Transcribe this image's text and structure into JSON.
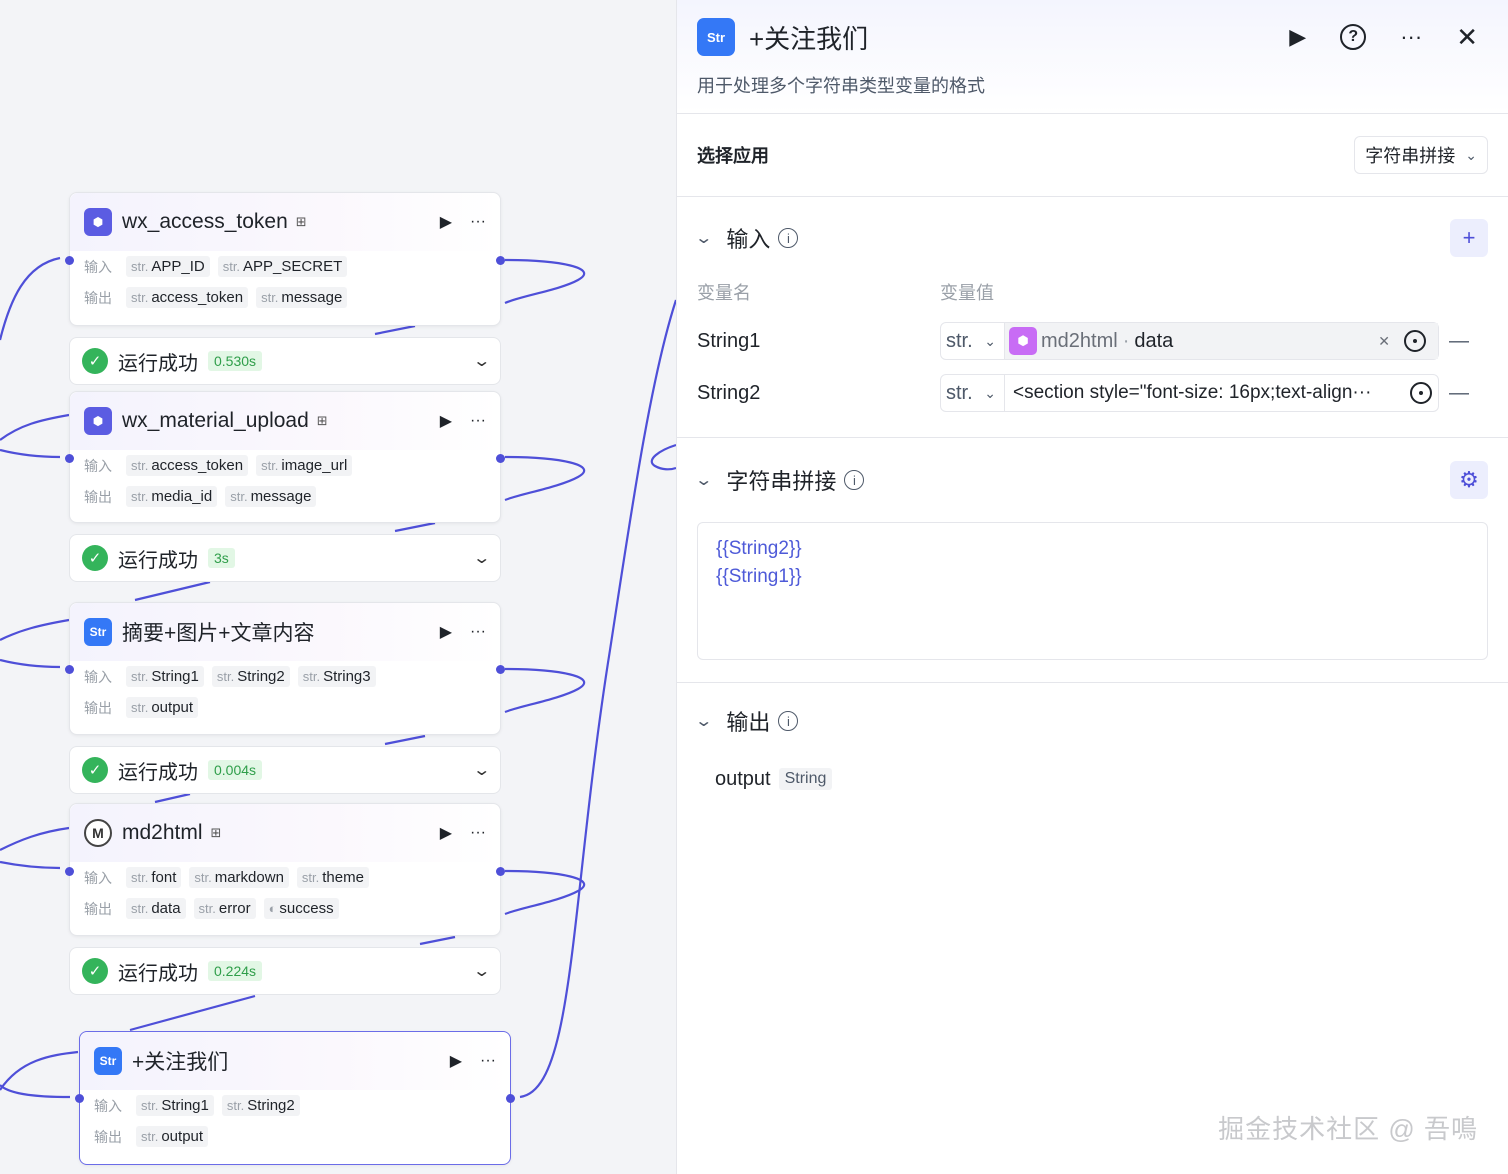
{
  "nodes": [
    {
      "title": "wx_access_token",
      "icon": "cube-icon",
      "inputs": [
        {
          "t": "str.",
          "n": "APP_ID"
        },
        {
          "t": "str.",
          "n": "APP_SECRET"
        }
      ],
      "outputs": [
        {
          "t": "str.",
          "n": "access_token"
        },
        {
          "t": "str.",
          "n": "message"
        }
      ]
    },
    {
      "title": "wx_material_upload",
      "icon": "cube-icon",
      "inputs": [
        {
          "t": "str.",
          "n": "access_token"
        },
        {
          "t": "str.",
          "n": "image_url"
        }
      ],
      "outputs": [
        {
          "t": "str.",
          "n": "media_id"
        },
        {
          "t": "str.",
          "n": "message"
        }
      ]
    },
    {
      "title": "摘要+图片+文章内容",
      "icon": "string-icon",
      "inputs": [
        {
          "t": "str.",
          "n": "String1"
        },
        {
          "t": "str.",
          "n": "String2"
        },
        {
          "t": "str.",
          "n": "String3"
        }
      ],
      "outputs": [
        {
          "t": "str.",
          "n": "output"
        }
      ]
    },
    {
      "title": "md2html",
      "icon": "md-icon",
      "inputs": [
        {
          "t": "str.",
          "n": "font"
        },
        {
          "t": "str.",
          "n": "markdown"
        },
        {
          "t": "str.",
          "n": "theme"
        }
      ],
      "outputs": [
        {
          "t": "str.",
          "n": "data"
        },
        {
          "t": "str.",
          "n": "error"
        },
        {
          "t": "",
          "n": "success"
        }
      ]
    },
    {
      "title": "+关注我们",
      "icon": "string-icon",
      "inputs": [
        {
          "t": "str.",
          "n": "String1"
        },
        {
          "t": "str.",
          "n": "String2"
        }
      ],
      "outputs": [
        {
          "t": "str.",
          "n": "output"
        }
      ]
    }
  ],
  "node_labels": {
    "input": "输入",
    "output": "输出",
    "str_icon_text": "Str",
    "md_icon_text": "M"
  },
  "statuses": [
    {
      "text": "运行成功",
      "duration": "0.530s"
    },
    {
      "text": "运行成功",
      "duration": "3s"
    },
    {
      "text": "运行成功",
      "duration": "0.004s"
    },
    {
      "text": "运行成功",
      "duration": "0.224s"
    }
  ],
  "panel": {
    "title": "+关注我们",
    "description": "用于处理多个字符串类型变量的格式",
    "select_app_label": "选择应用",
    "select_app_value": "字符串拼接",
    "input_section": {
      "title": "输入",
      "col_name": "变量名",
      "col_value": "变量值",
      "rows": [
        {
          "name": "String1",
          "type": "str.",
          "ref_source": "md2html",
          "ref_sep": "·",
          "ref_field": "data"
        },
        {
          "name": "String2",
          "type": "str.",
          "text_value": "<section style=\"font-size: 16px;text-align···"
        }
      ]
    },
    "concat_section": {
      "title": "字符串拼接",
      "template_lines": [
        "{{String2}}",
        "{{String1}}"
      ]
    },
    "output_section": {
      "title": "输出",
      "name": "output",
      "type": "String"
    }
  },
  "watermark": "掘金技术社区 @ 吾鳴",
  "colors": {
    "accent": "#4e4fd8",
    "success": "#34b45b",
    "panel_icon": "#3478f6",
    "ref_icon": "#c86cf5"
  }
}
